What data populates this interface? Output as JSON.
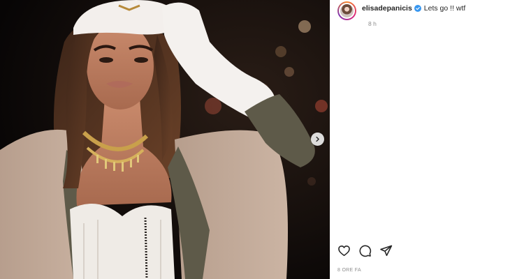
{
  "post": {
    "media": {
      "alt": "",
      "has_next": true,
      "next_icon": "chevron-right-icon"
    },
    "header": {
      "username": "elisadepanicis",
      "verified": true,
      "verified_icon": "verified-badge-icon",
      "caption": "Lets go !! wtf",
      "time": "8 h"
    },
    "actions": [
      {
        "name": "like",
        "icon": "heart-icon"
      },
      {
        "name": "comment",
        "icon": "comment-icon"
      },
      {
        "name": "share",
        "icon": "send-icon"
      }
    ],
    "footer": {
      "time": "8 ORE FA"
    },
    "colors": {
      "verified": "#3897f0",
      "text": "#262626",
      "muted": "#8e8e8e"
    }
  }
}
